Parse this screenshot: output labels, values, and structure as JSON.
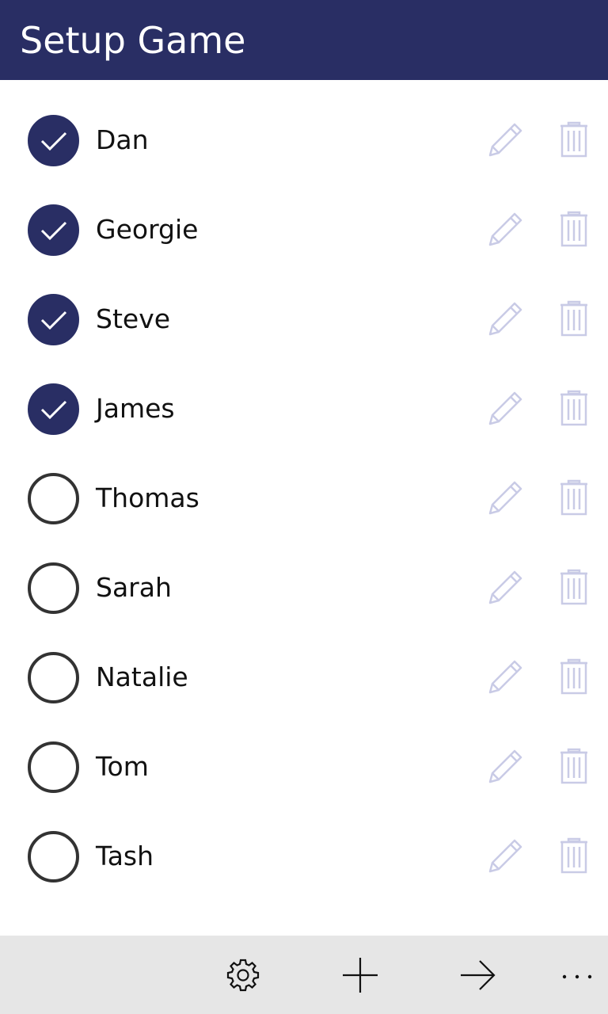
{
  "header": {
    "title": "Setup Game",
    "background": "#292e64"
  },
  "players": [
    {
      "name": "Dan",
      "selected": true
    },
    {
      "name": "Georgie",
      "selected": true
    },
    {
      "name": "Steve",
      "selected": true
    },
    {
      "name": "James",
      "selected": true
    },
    {
      "name": "Thomas",
      "selected": false
    },
    {
      "name": "Sarah",
      "selected": false
    },
    {
      "name": "Natalie",
      "selected": false
    },
    {
      "name": "Tom",
      "selected": false
    },
    {
      "name": "Tash",
      "selected": false
    }
  ],
  "row_icons": {
    "edit": "pencil-icon",
    "delete": "trash-icon",
    "color": "#c9cbe6"
  },
  "appbar": {
    "background": "#e6e6e6",
    "buttons": [
      "gear-icon",
      "plus-icon",
      "arrow-right-icon",
      "more-icon"
    ]
  },
  "colors": {
    "accent": "#292e64",
    "unchecked_border": "#333333"
  }
}
